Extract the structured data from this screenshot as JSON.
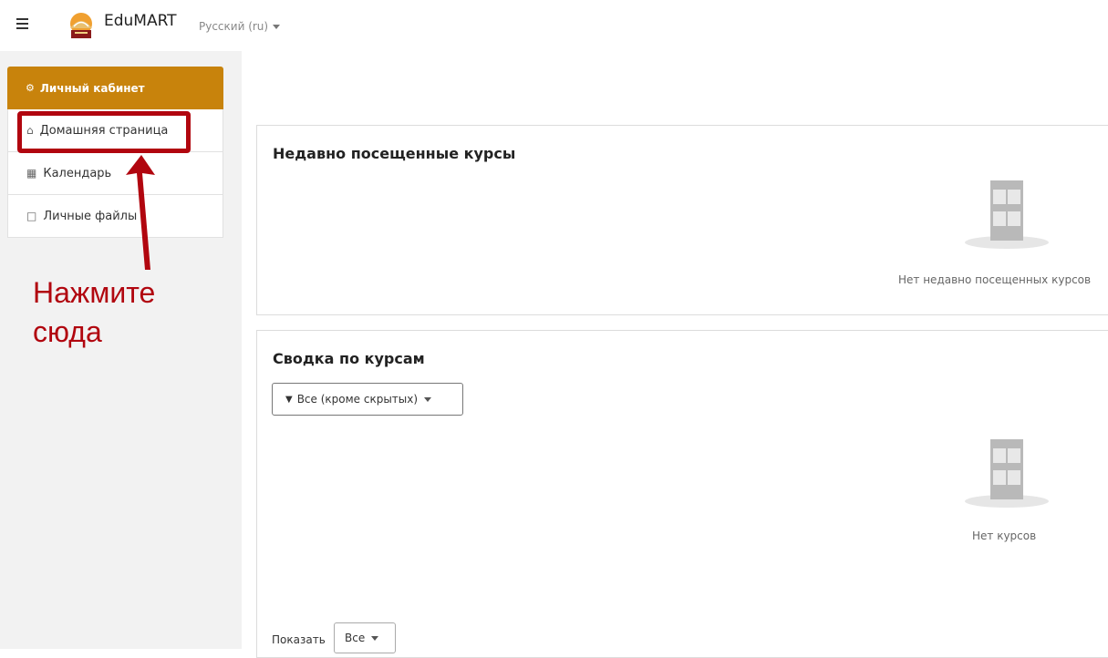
{
  "header": {
    "site_name": "EduMART",
    "language": "Русский (ru)"
  },
  "sidebar": {
    "header_label": "Личный кабинет",
    "items": [
      {
        "label": "Домашняя страница",
        "icon": "home-icon"
      },
      {
        "label": "Календарь",
        "icon": "calendar-icon"
      },
      {
        "label": "Личные файлы",
        "icon": "file-icon"
      }
    ]
  },
  "annotation": {
    "line1": "Нажмите",
    "line2": "сюда",
    "color": "#b1060f"
  },
  "recent": {
    "title": "Недавно посещенные курсы",
    "empty_text": "Нет недавно посещенных курсов"
  },
  "overview": {
    "title": "Сводка по курсам",
    "filter_label": "Все (кроме скрытых)",
    "empty_text": "Нет курсов",
    "show_label": "Показать",
    "show_value": "Все"
  },
  "colors": {
    "accent": "#c8830c",
    "annotation": "#b1060f"
  }
}
